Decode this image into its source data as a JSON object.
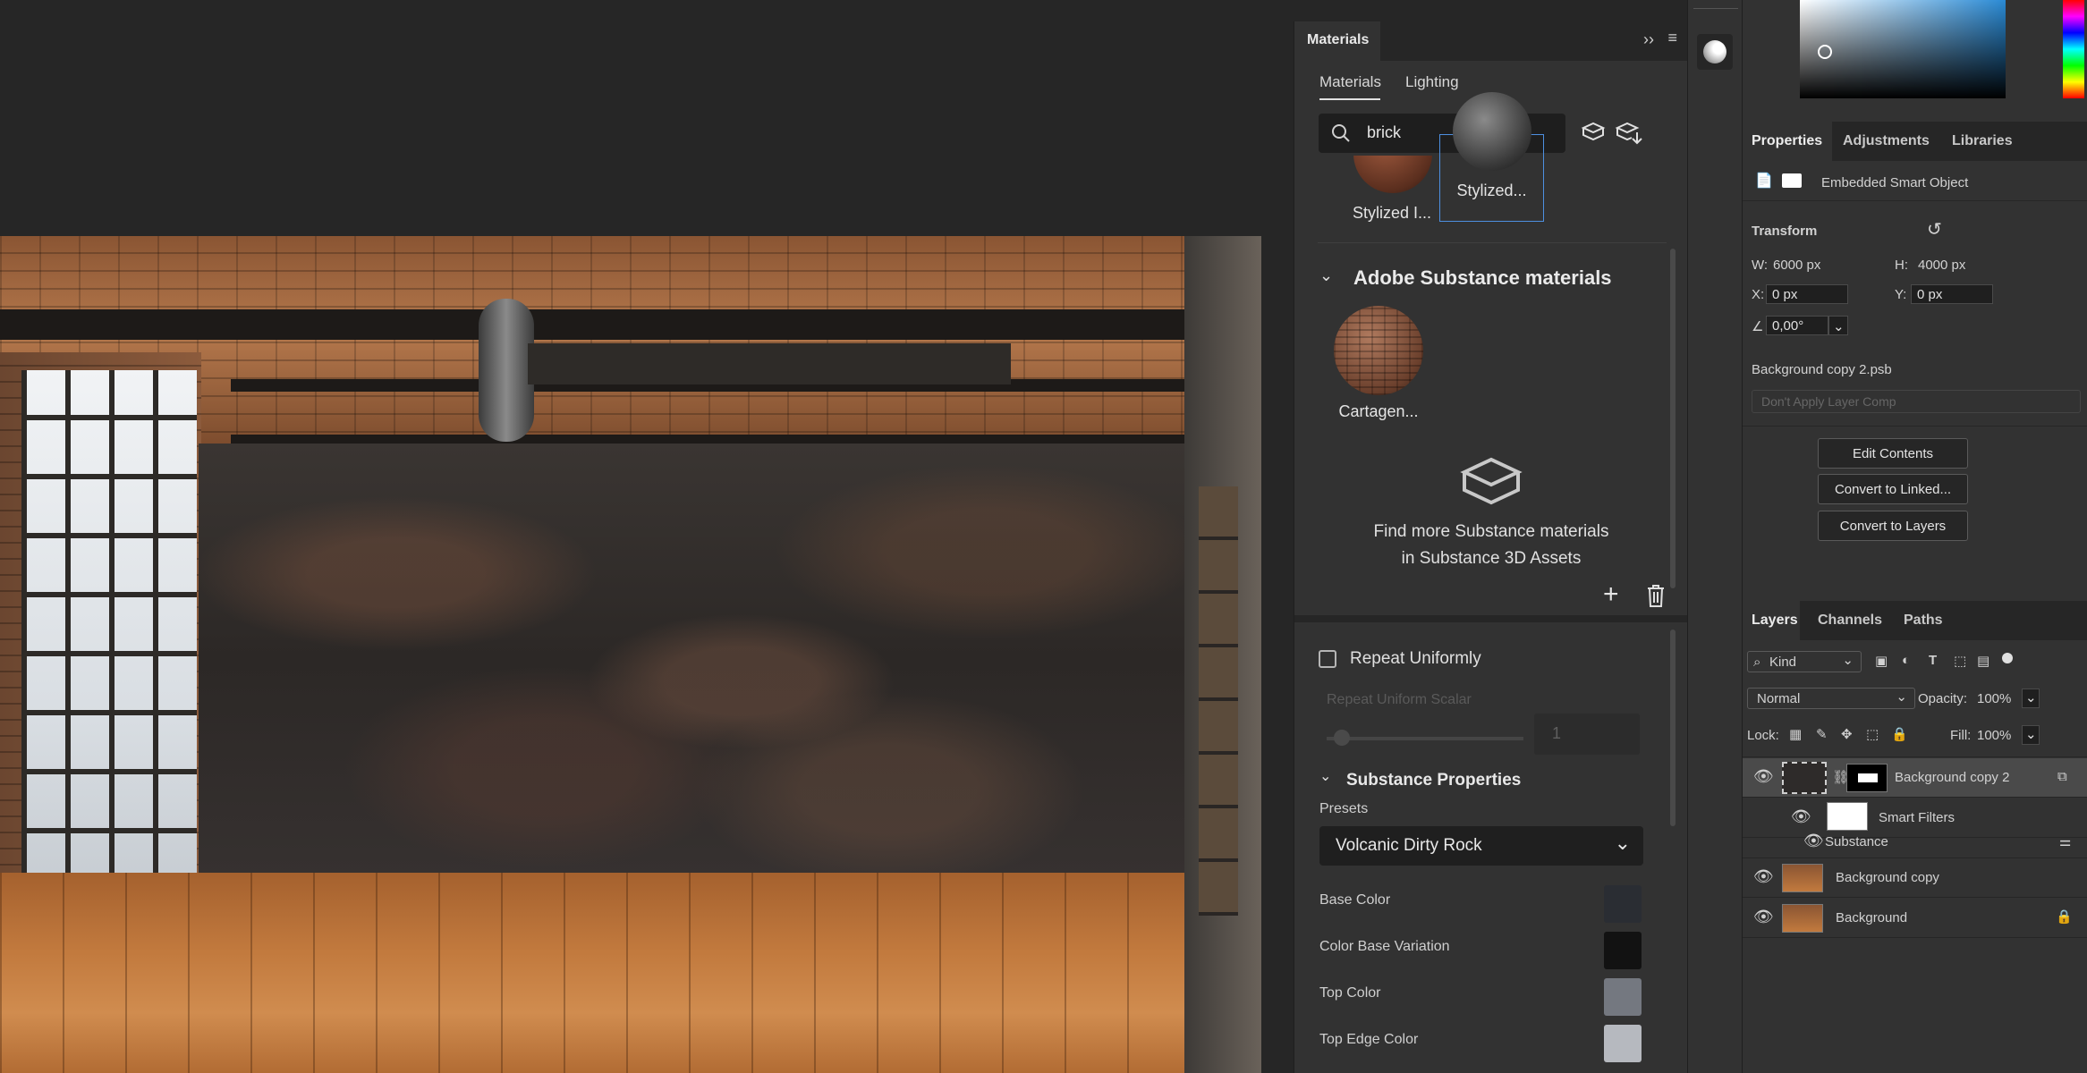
{
  "materials_panel": {
    "panel_title": "Materials",
    "tabs": [
      "Materials",
      "Lighting"
    ],
    "search_value": "brick",
    "results": [
      {
        "label": "Stylized I..."
      },
      {
        "label": "Stylized..."
      }
    ],
    "section_title": "Adobe Substance materials",
    "substance_items": [
      {
        "label": "Cartagen..."
      }
    ],
    "find_more_line1": "Find more Substance materials",
    "find_more_line2": "in Substance 3D Assets",
    "repeat_uniformly": "Repeat Uniformly",
    "repeat_uniform_scalar": "Repeat Uniform Scalar",
    "repeat_value": "1",
    "substance_properties_title": "Substance Properties",
    "presets_label": "Presets",
    "preset_value": "Volcanic Dirty Rock",
    "color_props": [
      {
        "label": "Base Color",
        "color": "#2a2d33"
      },
      {
        "label": "Color Base Variation",
        "color": "#121212"
      },
      {
        "label": "Top Color",
        "color": "#747880"
      },
      {
        "label": "Top Edge Color",
        "color": "#b6b9bf"
      }
    ]
  },
  "properties": {
    "tabs": [
      "Properties",
      "Adjustments",
      "Libraries"
    ],
    "object_type": "Embedded Smart Object",
    "transform_title": "Transform",
    "w_label": "W:",
    "w_value": "6000 px",
    "h_label": "H:",
    "h_value": "4000 px",
    "x_label": "X:",
    "x_value": "0 px",
    "y_label": "Y:",
    "y_value": "0 px",
    "angle_value": "0,00°",
    "file_name": "Background copy 2.psb",
    "layer_comp": "Don't Apply Layer Comp",
    "buttons": [
      "Edit Contents",
      "Convert to Linked...",
      "Convert to Layers"
    ]
  },
  "layers": {
    "tabs": [
      "Layers",
      "Channels",
      "Paths"
    ],
    "kind_label": "Kind",
    "blend_mode": "Normal",
    "opacity_label": "Opacity:",
    "opacity_value": "100%",
    "lock_label": "Lock:",
    "fill_label": "Fill:",
    "fill_value": "100%",
    "items": [
      {
        "name": "Background copy 2"
      },
      {
        "name": "Smart Filters"
      },
      {
        "name": "Substance"
      },
      {
        "name": "Background copy"
      },
      {
        "name": "Background"
      }
    ]
  }
}
